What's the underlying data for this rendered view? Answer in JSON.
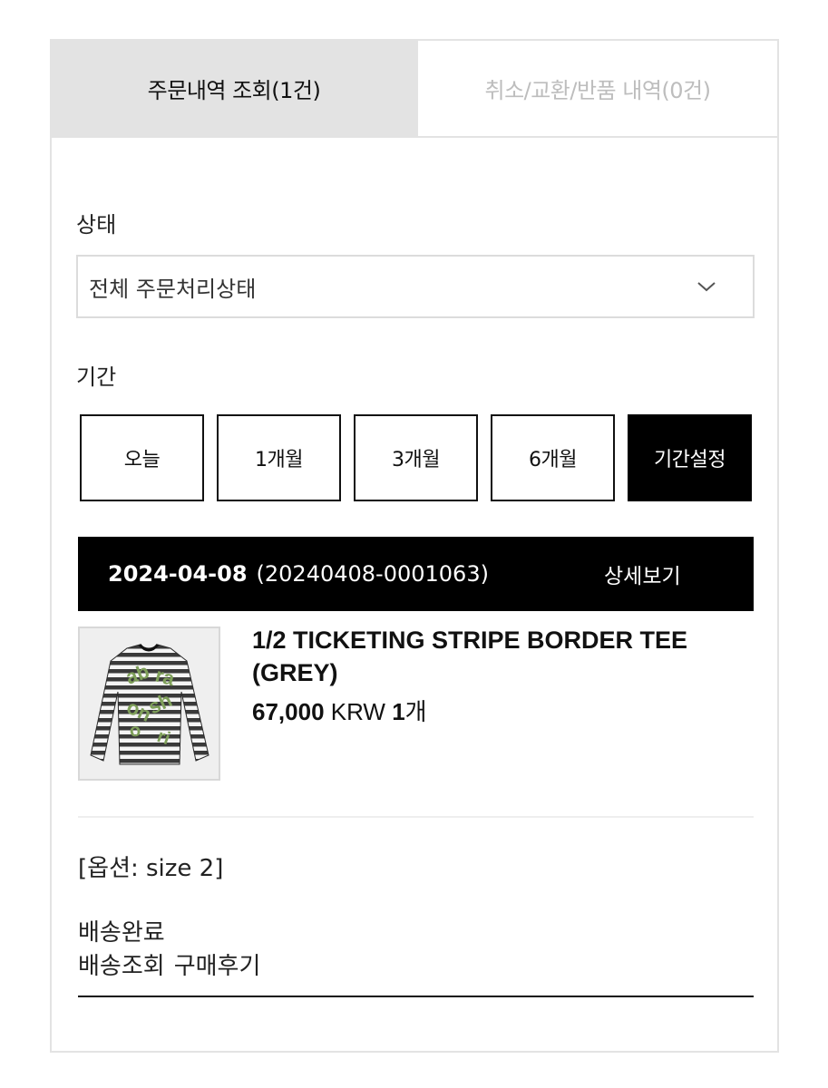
{
  "tabs": [
    {
      "label": "주문내역 조회(1건)",
      "active": true
    },
    {
      "label": "취소/교환/반품 내역(0건)",
      "active": false
    }
  ],
  "filter": {
    "status_label": "상태",
    "status_value": "전체 주문처리상태",
    "period_label": "기간",
    "periods": [
      {
        "label": "오늘",
        "active": false
      },
      {
        "label": "1개월",
        "active": false
      },
      {
        "label": "3개월",
        "active": false
      },
      {
        "label": "6개월",
        "active": false
      },
      {
        "label": "기간설정",
        "active": true
      }
    ]
  },
  "order": {
    "date": "2024-04-08",
    "number": "(20240408-0001063)",
    "detail_label": "상세보기",
    "item": {
      "name": "1/2 TICKETING STRIPE BORDER TEE (GREY)",
      "price": "67,000",
      "currency": "KRW",
      "quantity": "1",
      "quantity_unit": "개",
      "image_icon": "striped-tee-thumbnail",
      "option": "[옵션: size 2]"
    },
    "status": "배송완료",
    "actions": [
      "배송조회",
      "구매후기"
    ]
  },
  "colors": {
    "active_tab_bg": "#e3e3e3",
    "inactive_tab_text": "#bdbdbd",
    "primary_black": "#000000",
    "border_grey": "#dcdcdc",
    "tee_print_green": "#7fa05a"
  }
}
